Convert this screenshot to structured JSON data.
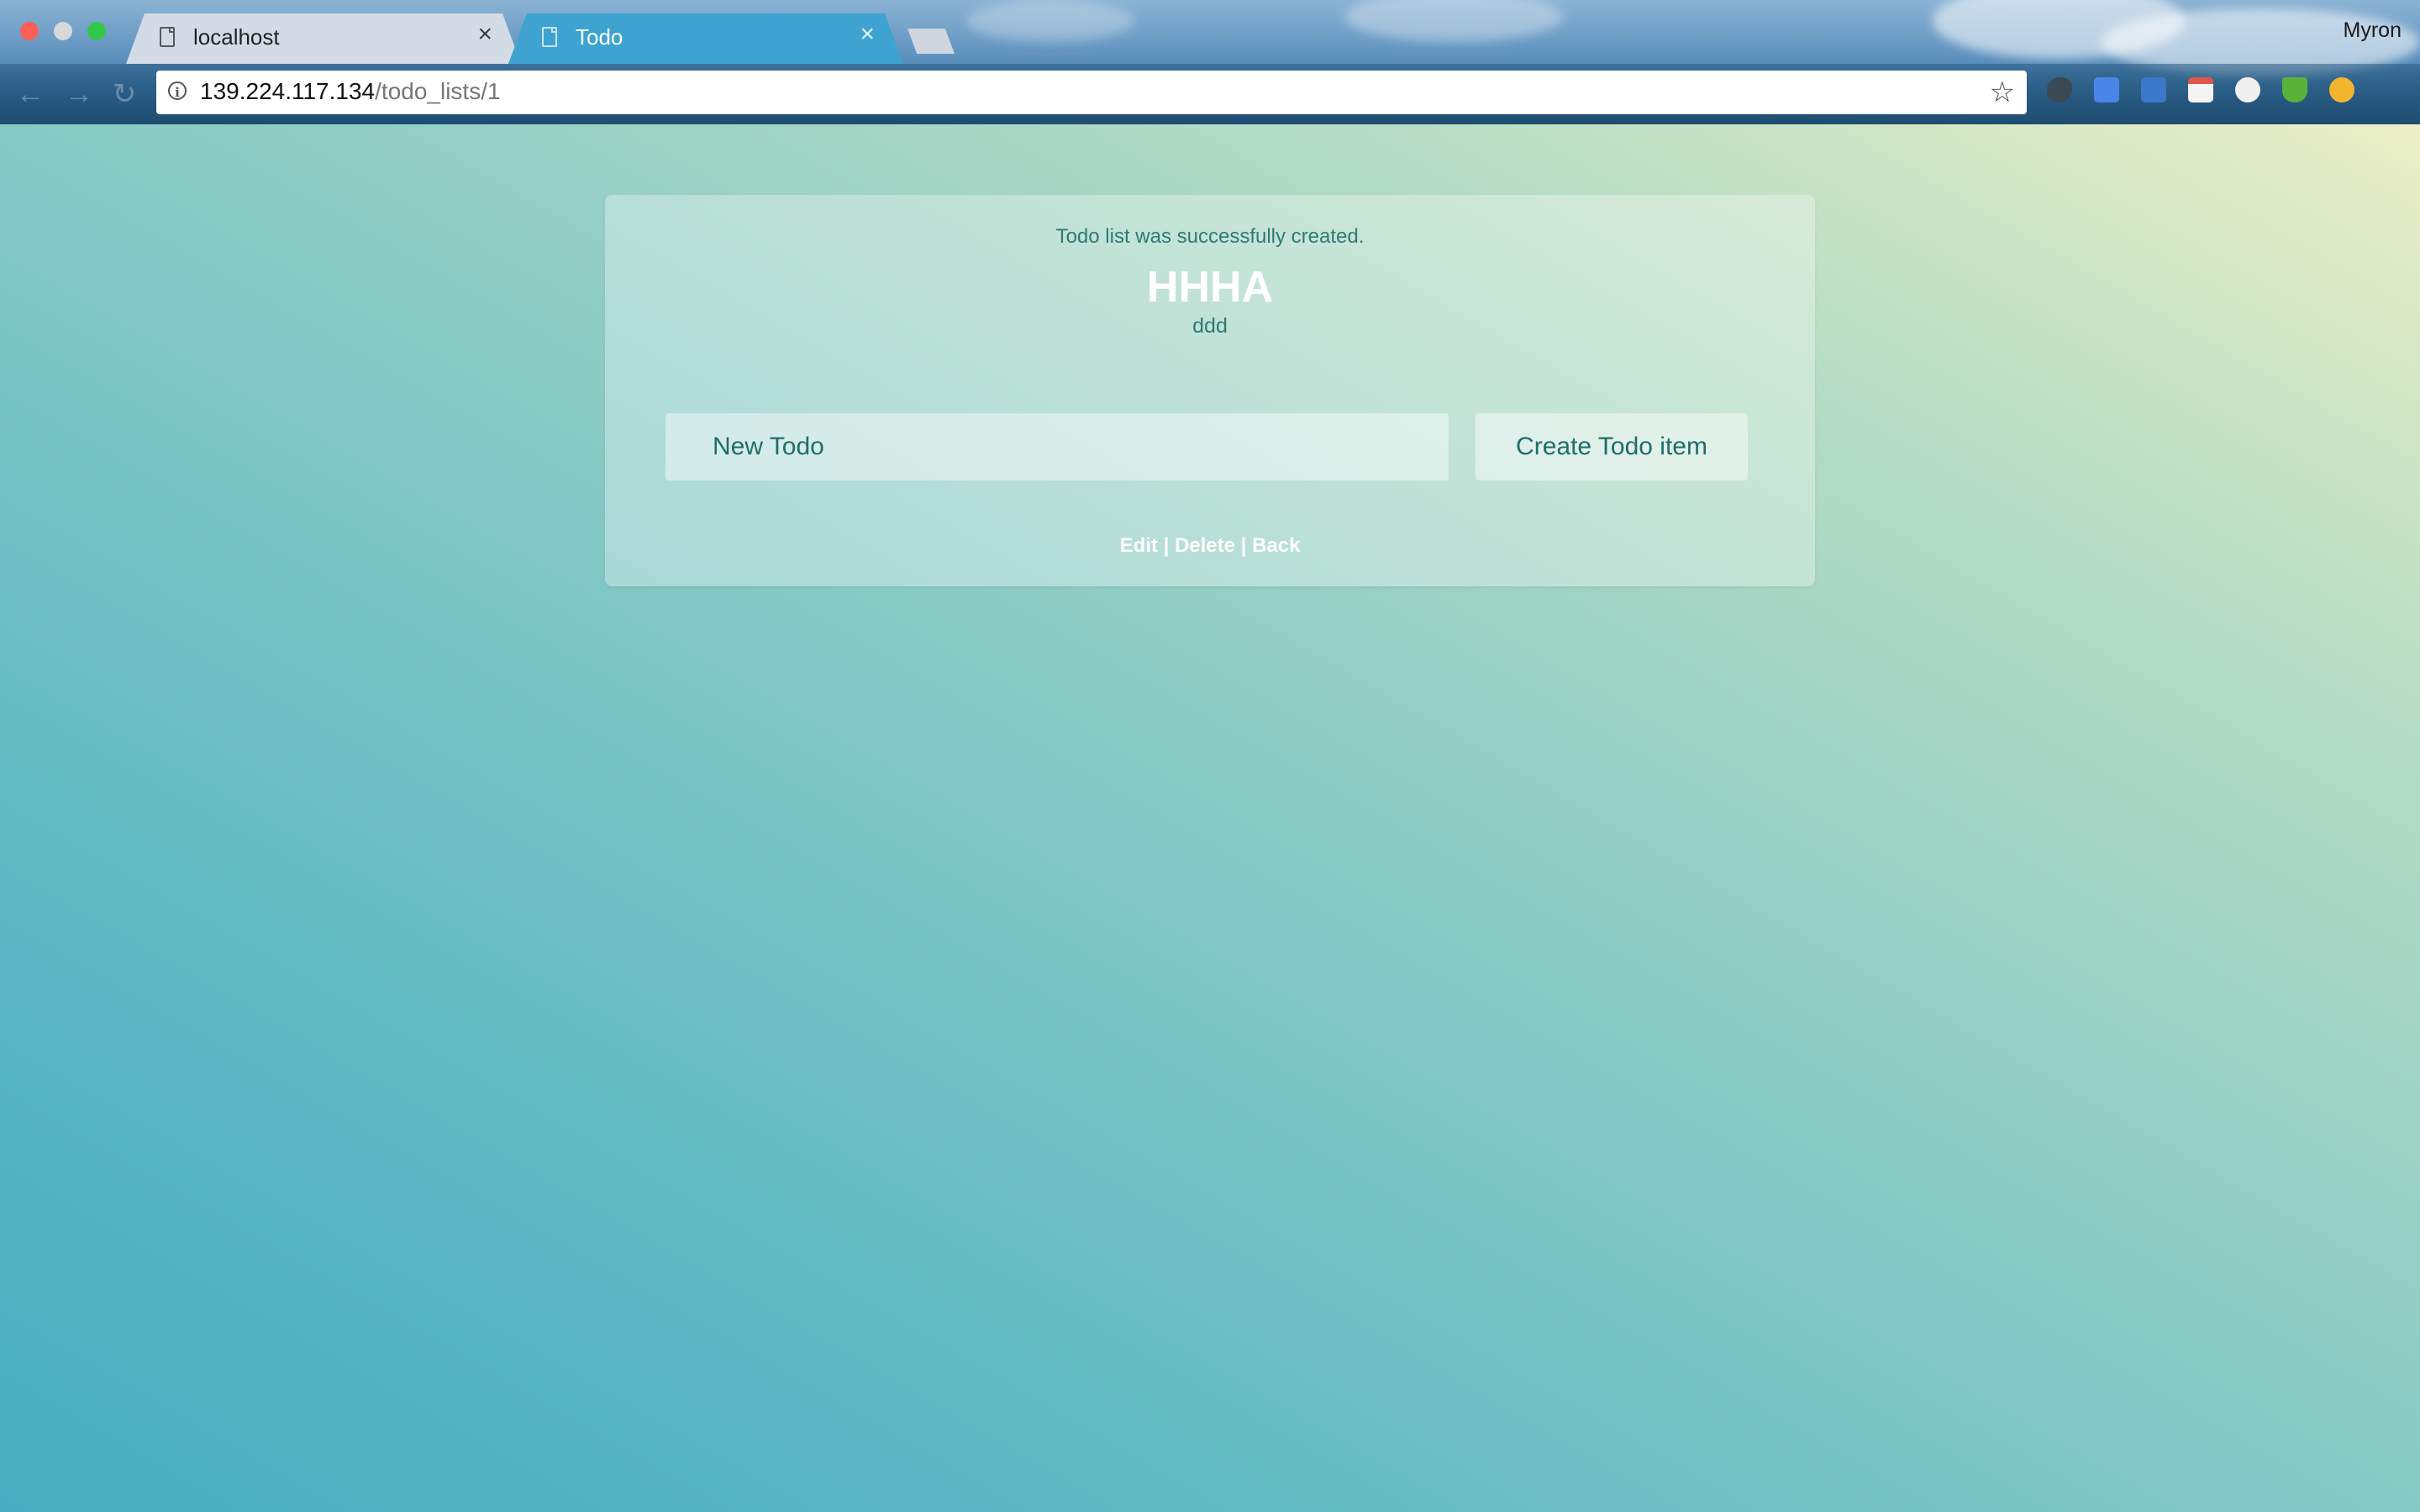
{
  "browser": {
    "profile_name": "Myron",
    "tabs": [
      {
        "title": "localhost",
        "close": "×"
      },
      {
        "title": "Todo",
        "close": "×"
      }
    ],
    "url_host": "139.224.117.134",
    "url_path": "/todo_lists/1",
    "icons": [
      "info-icon",
      "star-icon",
      "evernote-icon",
      "google-translate-icon",
      "screenshot-icon",
      "calendar-icon",
      "clock-icon",
      "shield-icon",
      "compass-icon"
    ]
  },
  "page": {
    "flash_notice": "Todo list was successfully created.",
    "list_title": "HHHA",
    "list_description": "ddd",
    "new_todo_placeholder": "New Todo",
    "create_button": "Create Todo item",
    "actions": {
      "edit": "Edit",
      "delete": "Delete",
      "back": "Back",
      "separator": "|"
    }
  },
  "colors": {
    "accent_text": "#1f6e69",
    "active_tab": "#3fa3d1"
  }
}
